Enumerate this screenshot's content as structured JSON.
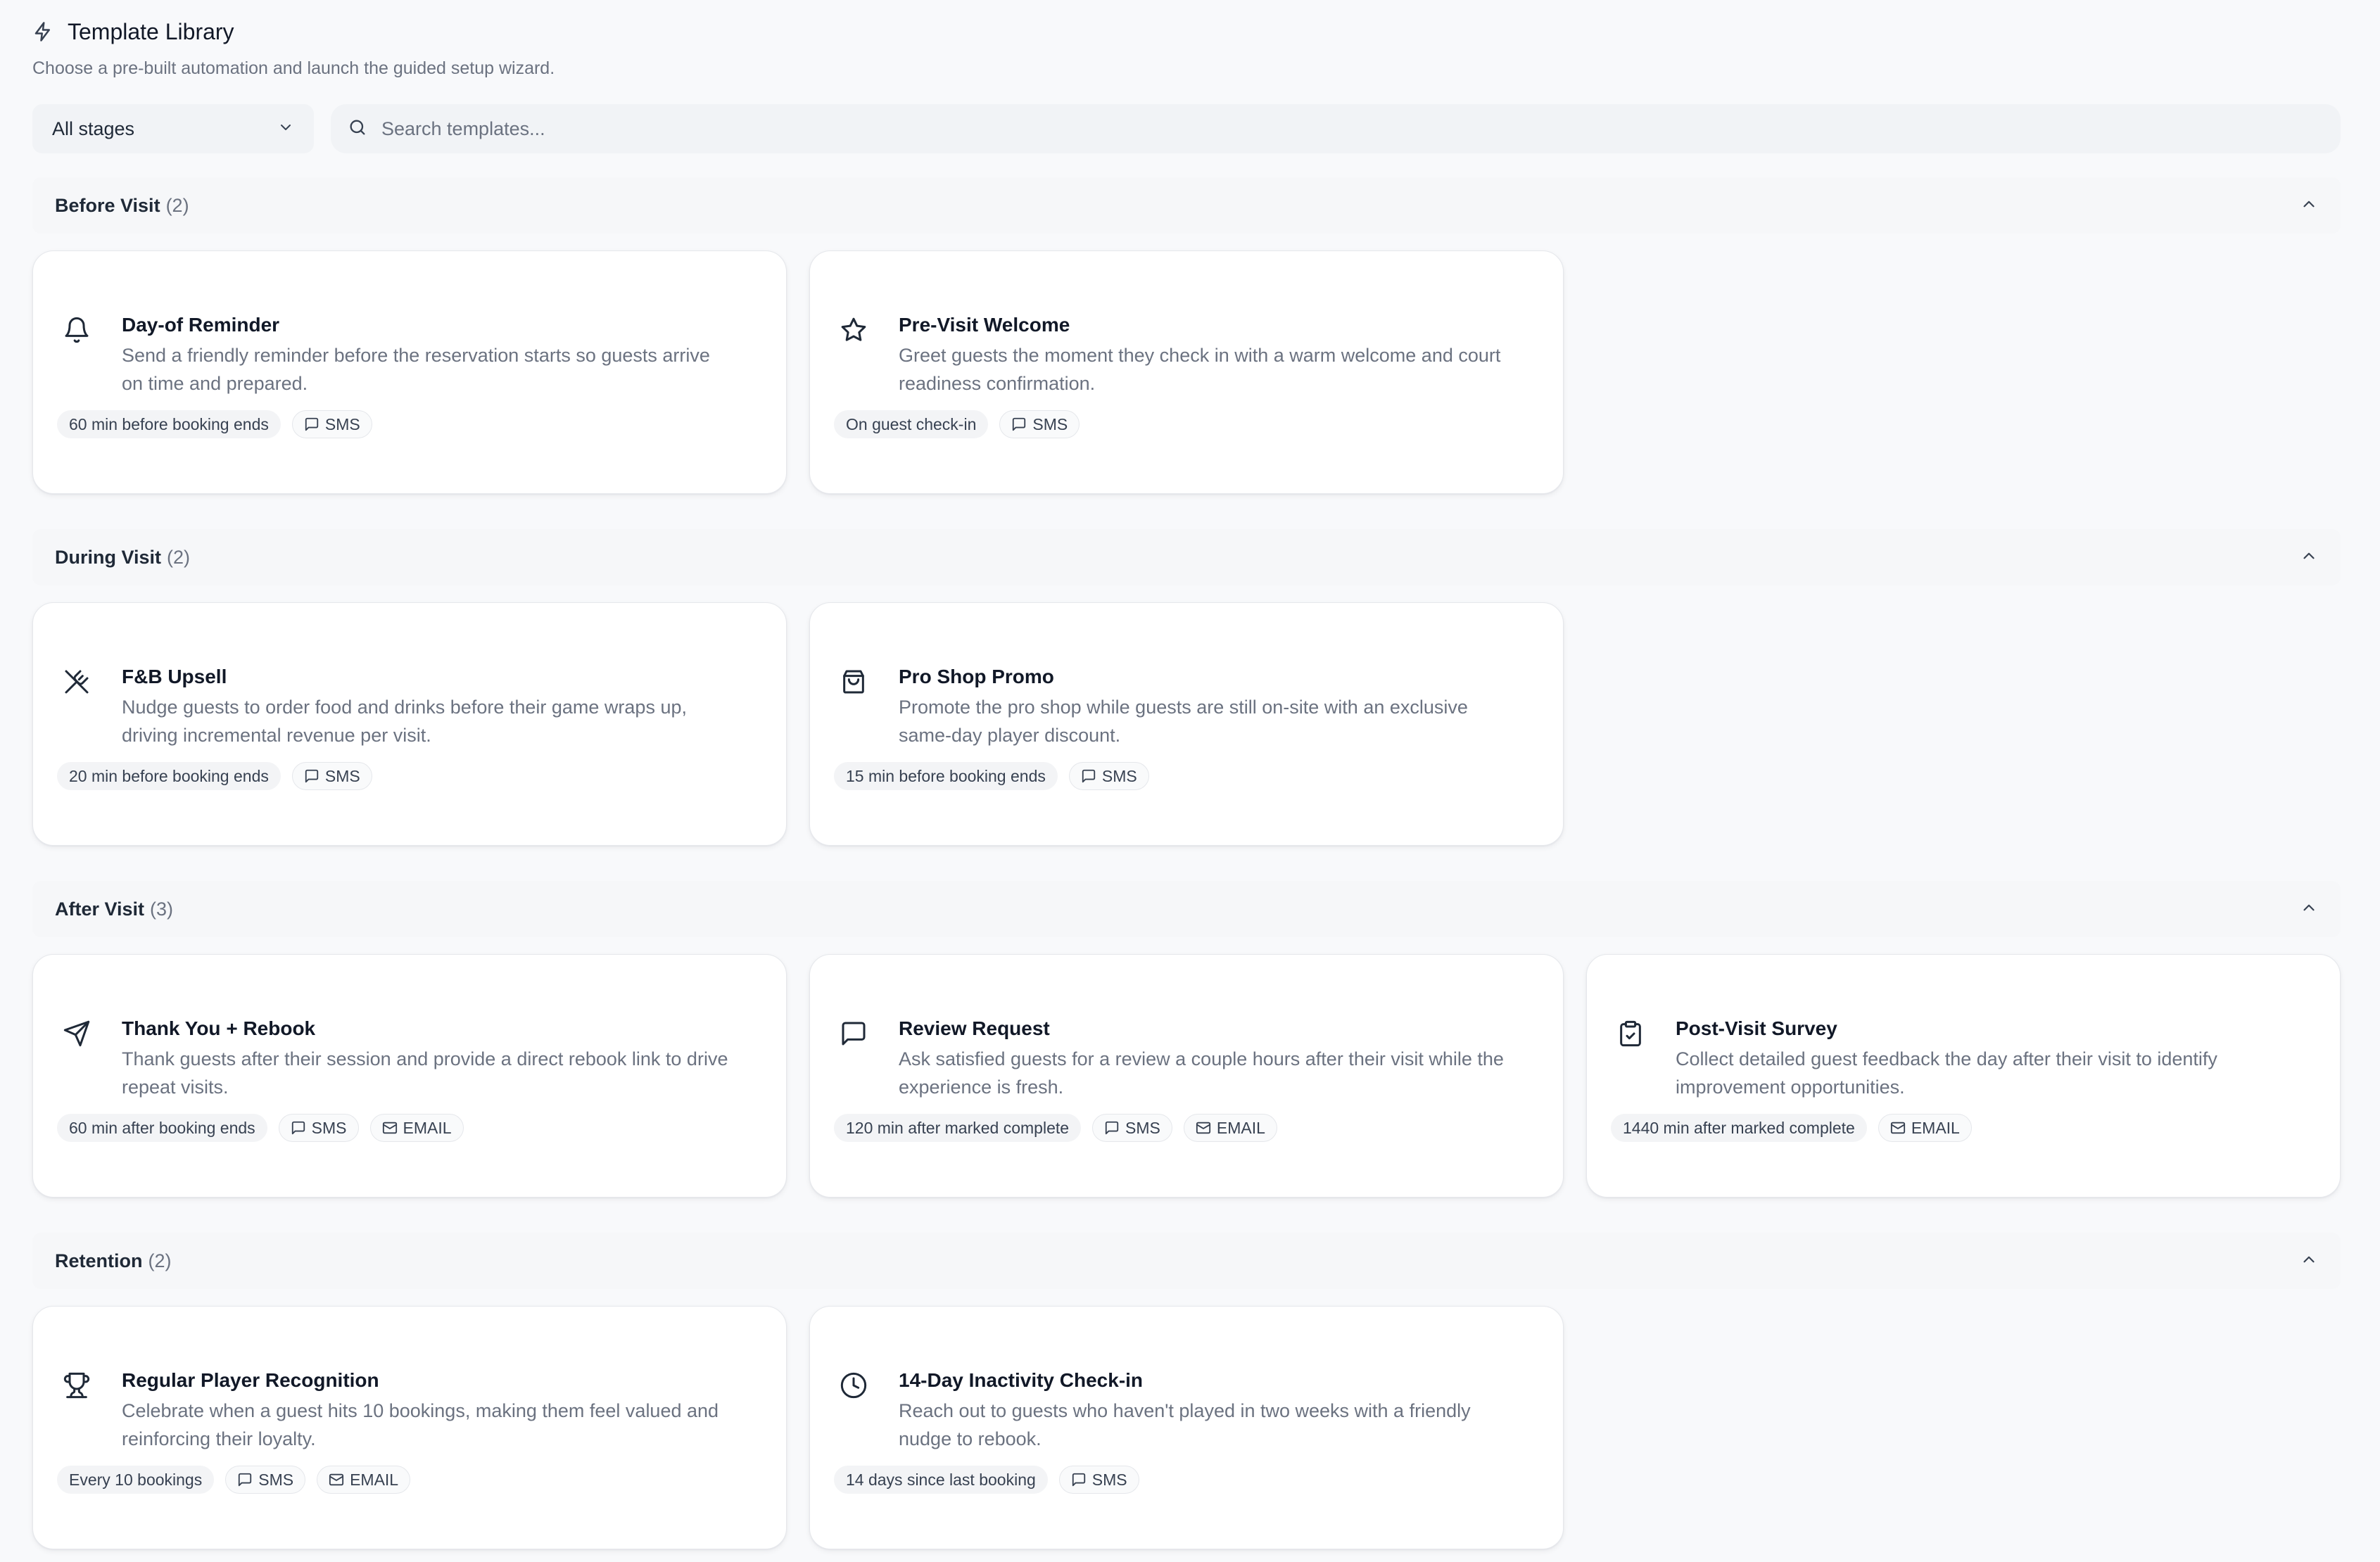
{
  "header": {
    "title": "Template Library",
    "subtitle": "Choose a pre-built automation and launch the guided setup wizard.",
    "icon": "lightning-bolt-icon"
  },
  "filters": {
    "stage_selected": "All stages",
    "search_placeholder": "Search templates..."
  },
  "sections": [
    {
      "name": "Before Visit",
      "count": "(2)",
      "cards": [
        {
          "title": "Day-of Reminder",
          "desc_line1": "Send a friendly reminder before the reservation starts so guests arrive",
          "desc_line2": "on time and prepared.",
          "timing": "60 min before booking ends",
          "channels": [
            "SMS"
          ],
          "icon": "bell-icon"
        },
        {
          "title": "Pre-Visit Welcome",
          "desc_line1": "Greet guests the moment they check in with a warm welcome and court",
          "desc_line2": "readiness confirmation.",
          "timing": "On guest check-in",
          "channels": [
            "SMS"
          ],
          "icon": "star-icon"
        }
      ]
    },
    {
      "name": "During Visit",
      "count": "(2)",
      "cards": [
        {
          "title": "F&B Upsell",
          "desc_line1": "Nudge guests to order food and drinks before their game wraps up,",
          "desc_line2": "driving incremental revenue per visit.",
          "timing": "20 min before booking ends",
          "channels": [
            "SMS"
          ],
          "icon": "utensils-crossed-icon"
        },
        {
          "title": "Pro Shop Promo",
          "desc_line1": "Promote the pro shop while guests are still on-site with an exclusive",
          "desc_line2": "same-day player discount.",
          "timing": "15 min before booking ends",
          "channels": [
            "SMS"
          ],
          "icon": "shopping-bag-icon"
        }
      ]
    },
    {
      "name": "After Visit",
      "count": "(3)",
      "cards": [
        {
          "title": "Thank You + Rebook",
          "desc_line1": "Thank guests after their session and provide a direct rebook link to drive",
          "desc_line2": "repeat visits.",
          "timing": "60 min after booking ends",
          "channels": [
            "SMS",
            "EMAIL"
          ],
          "icon": "send-icon"
        },
        {
          "title": "Review Request",
          "desc_line1": "Ask satisfied guests for a review a couple hours after their visit while the",
          "desc_line2": "experience is fresh.",
          "timing": "120 min after marked complete",
          "channels": [
            "SMS",
            "EMAIL"
          ],
          "icon": "message-square-icon"
        },
        {
          "title": "Post-Visit Survey",
          "desc_line1": "Collect detailed guest feedback the day after their visit to identify",
          "desc_line2": "improvement opportunities.",
          "timing": "1440 min after marked complete",
          "channels": [
            "EMAIL"
          ],
          "icon": "clipboard-check-icon"
        }
      ]
    },
    {
      "name": "Retention",
      "count": "(2)",
      "cards": [
        {
          "title": "Regular Player Recognition",
          "desc_line1": "Celebrate when a guest hits 10 bookings, making them feel valued and",
          "desc_line2": "reinforcing their loyalty.",
          "timing": "Every 10 bookings",
          "channels": [
            "SMS",
            "EMAIL"
          ],
          "icon": "trophy-icon"
        },
        {
          "title": "14-Day Inactivity Check-in",
          "desc_line1": "Reach out to guests who haven't played in two weeks with a friendly",
          "desc_line2": "nudge to rebook.",
          "timing": "14 days since last booking",
          "channels": [
            "SMS"
          ],
          "icon": "clock-icon"
        }
      ]
    }
  ],
  "colors": {
    "background": "#f8f9fb",
    "card": "#ffffff",
    "text_primary": "#111827",
    "text_muted": "#6b7280",
    "input_bg": "#f1f3f6"
  }
}
